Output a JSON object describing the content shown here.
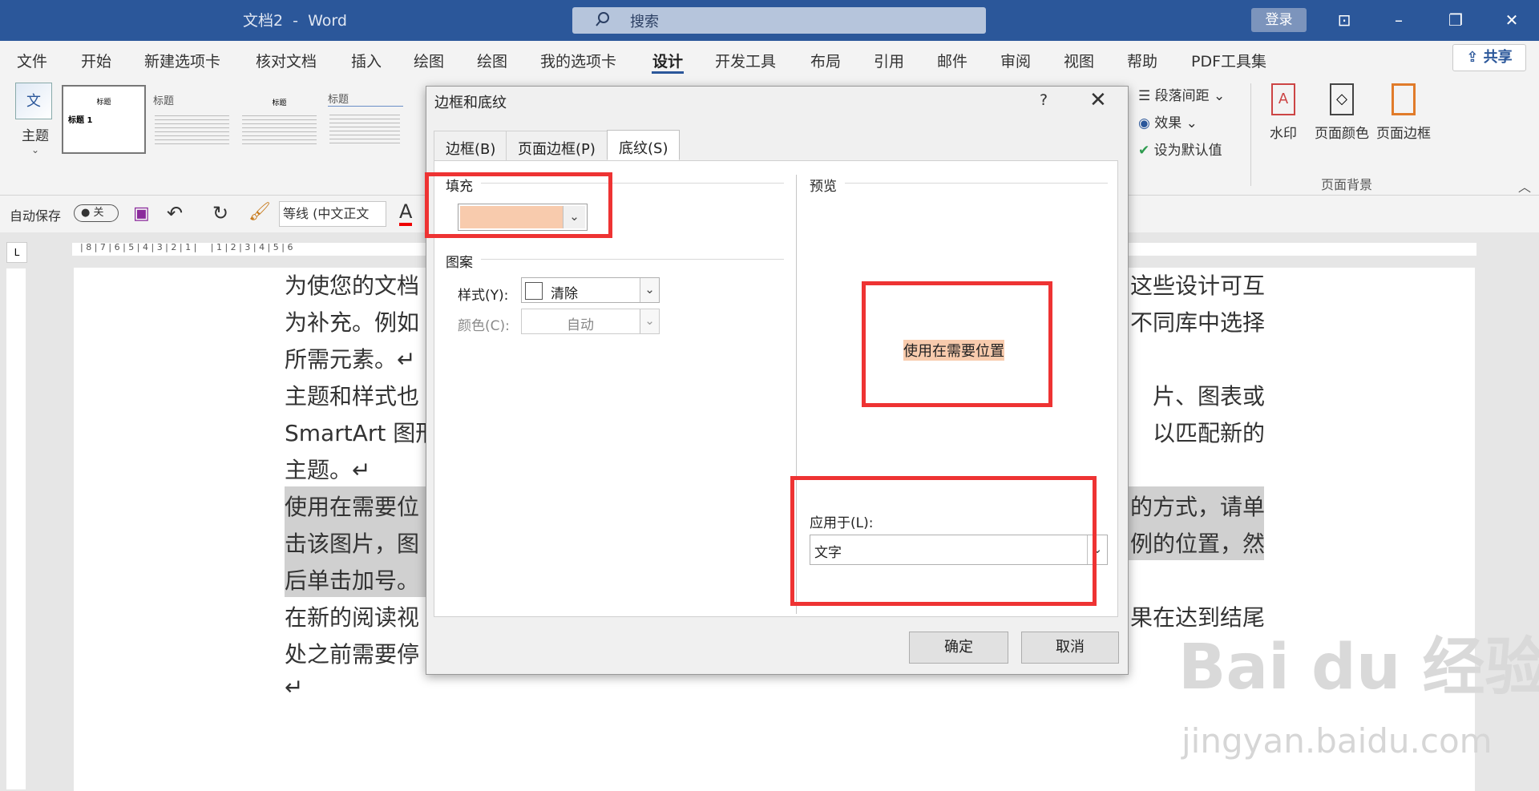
{
  "window": {
    "title": "文档2  -  Word",
    "search_placeholder": "搜索",
    "login": "登录"
  },
  "menu": {
    "tabs": [
      "文件",
      "开始",
      "新建选项卡",
      "核对文档",
      "插入",
      "绘图",
      "绘图",
      "我的选项卡",
      "设计",
      "开发工具",
      "布局",
      "引用",
      "邮件",
      "审阅",
      "视图",
      "帮助",
      "PDF工具集"
    ],
    "active_index": 8,
    "share": "共享"
  },
  "ribbon": {
    "theme_label": "主题",
    "style_thumbs": [
      "标题",
      "标题",
      "标题",
      "标题"
    ],
    "thumb_heading": "标题 1",
    "right_items": {
      "paragraph_spacing": "段落间距",
      "effects": "效果",
      "set_default": "设为默认值"
    },
    "page_bg_buttons": [
      "水印",
      "页面颜色",
      "页面边框"
    ],
    "page_bg_group": "页面背景"
  },
  "qat": {
    "autosave": "自动保存",
    "toggle": "关",
    "font": "等线 (中文正文"
  },
  "document": {
    "lines": [
      {
        "left": "为使您的文档",
        "right": "这些设计可互"
      },
      {
        "left": "为补充。例如",
        "right": "不同库中选择"
      },
      {
        "left": "所需元素。↵",
        "right": ""
      },
      {
        "left": "主题和样式也",
        "right": "片、图表或"
      },
      {
        "left": "SmartArt 图形",
        "right": "以匹配新的"
      },
      {
        "left": "主题。↵",
        "right": ""
      },
      {
        "left": "使用在需要位",
        "right": "的方式，请单"
      },
      {
        "left": "击该图片，图",
        "right": "例的位置，然"
      },
      {
        "left": "后单击加号。",
        "right": ""
      },
      {
        "left": "在新的阅读视",
        "right": "果在达到结尾"
      },
      {
        "left": "处之前需要停",
        "right": ""
      },
      {
        "left": "↵",
        "right": ""
      }
    ]
  },
  "dialog": {
    "title": "边框和底纹",
    "help": "?",
    "close": "✕",
    "tabs": [
      "边框(B)",
      "页面边框(P)",
      "底纹(S)"
    ],
    "active_tab": 2,
    "fill_label": "填充",
    "fill_color": "#f8cbad",
    "pattern_label": "图案",
    "style_label": "样式(Y):",
    "style_value": "清除",
    "color_label": "颜色(C):",
    "color_value": "自动",
    "preview_label": "预览",
    "preview_text": "使用在需要位置",
    "apply_label": "应用于(L):",
    "apply_value": "文字",
    "ok": "确定",
    "cancel": "取消"
  },
  "watermark": {
    "brand": "Bai du 经验",
    "url": "jingyan.baidu.com"
  },
  "colors": {
    "titlebar": "#2b579a",
    "highlight_box": "#ee3333",
    "shading": "#f8cbad"
  }
}
